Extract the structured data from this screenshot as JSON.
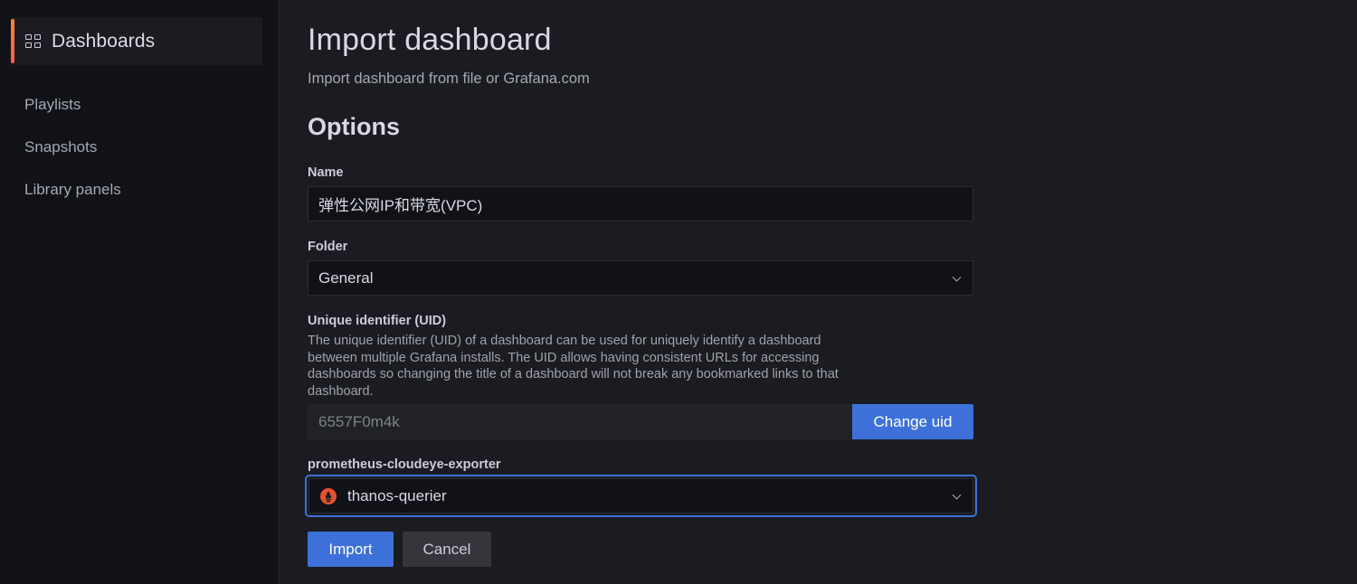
{
  "sidebar": {
    "active": {
      "label": "Dashboards",
      "icon": "apps-grid-icon"
    },
    "items": [
      {
        "label": "Playlists"
      },
      {
        "label": "Snapshots"
      },
      {
        "label": "Library panels"
      }
    ]
  },
  "page": {
    "title": "Import dashboard",
    "subtitle": "Import dashboard from file or Grafana.com",
    "section": "Options"
  },
  "form": {
    "name": {
      "label": "Name",
      "value": "弹性公网IP和带宽(VPC)"
    },
    "folder": {
      "label": "Folder",
      "value": "General"
    },
    "uid": {
      "label": "Unique identifier (UID)",
      "description": "The unique identifier (UID) of a dashboard can be used for uniquely identify a dashboard between multiple Grafana installs. The UID allows having consistent URLs for accessing dashboards so changing the title of a dashboard will not break any bookmarked links to that dashboard.",
      "value": "6557F0m4k",
      "change_button": "Change uid"
    },
    "datasource": {
      "label": "prometheus-cloudeye-exporter",
      "value": "thanos-querier",
      "icon": "prometheus-icon"
    }
  },
  "actions": {
    "import_label": "Import",
    "cancel_label": "Cancel"
  },
  "colors": {
    "accent_orange": "#f55f3e",
    "primary_blue": "#3d71d9",
    "prometheus_red": "#e6522c"
  }
}
